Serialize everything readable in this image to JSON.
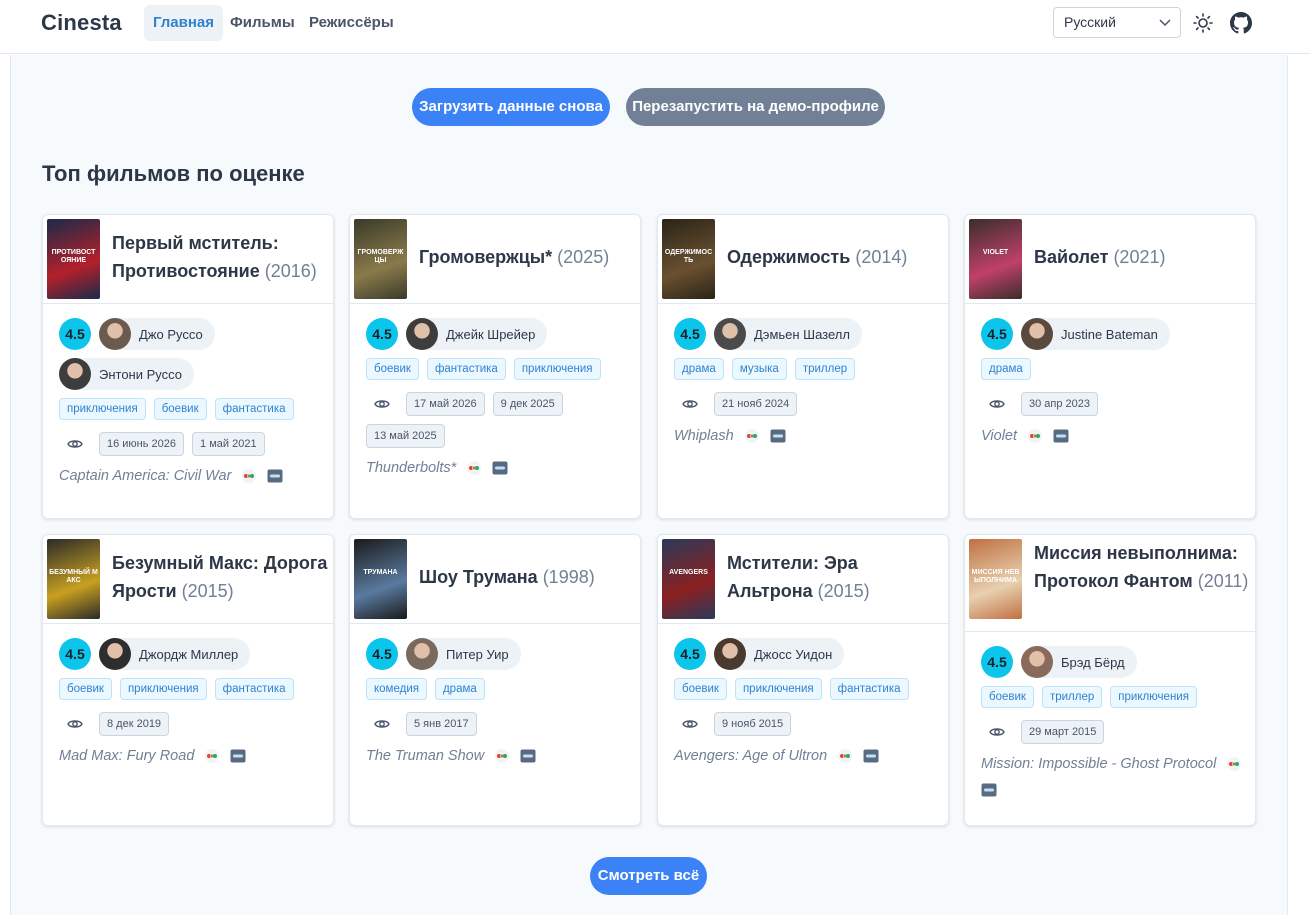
{
  "header": {
    "brand": "Cinesta",
    "nav": [
      {
        "label": "Главная",
        "active": true
      },
      {
        "label": "Фильмы",
        "active": false
      },
      {
        "label": "Режиссёры",
        "active": false
      }
    ],
    "language": "Русский"
  },
  "actions": {
    "reload_label": "Загрузить данные снова",
    "restart_label": "Перезапустить на демо-профиле"
  },
  "section_title": "Топ фильмов по оценке",
  "see_all_label": "Смотреть всё",
  "colors": {
    "accent": "#3b82f6",
    "rating": "#0bc5ea",
    "gray_button": "#718096"
  },
  "movies": [
    {
      "title": "Первый мститель: Противостояние",
      "year": "(2016)",
      "rating": "4.5",
      "directors": [
        "Джо Руссо",
        "Энтони Руссо"
      ],
      "genres": [
        "приключения",
        "боевик",
        "фантастика"
      ],
      "dates": [
        "16 июнь 2026",
        "1 май 2021"
      ],
      "original_title": "Captain America: Civil War"
    },
    {
      "title": "Громовержцы*",
      "year": "(2025)",
      "rating": "4.5",
      "directors": [
        "Джейк Шрейер"
      ],
      "genres": [
        "боевик",
        "фантастика",
        "приключения"
      ],
      "dates": [
        "17 май 2026",
        "9 дек 2025",
        "13 май 2025"
      ],
      "original_title": "Thunderbolts*"
    },
    {
      "title": "Одержимость",
      "year": "(2014)",
      "rating": "4.5",
      "directors": [
        "Дэмьен Шазелл"
      ],
      "genres": [
        "драма",
        "музыка",
        "триллер"
      ],
      "dates": [
        "21 нояб 2024"
      ],
      "original_title": "Whiplash"
    },
    {
      "title": "Вайолет",
      "year": "(2021)",
      "rating": "4.5",
      "directors": [
        "Justine Bateman"
      ],
      "genres": [
        "драма"
      ],
      "dates": [
        "30 апр 2023"
      ],
      "original_title": "Violet"
    },
    {
      "title": "Безумный Макс: Дорога Ярости",
      "year": "(2015)",
      "rating": "4.5",
      "directors": [
        "Джордж Миллер"
      ],
      "genres": [
        "боевик",
        "приключения",
        "фантастика"
      ],
      "dates": [
        "8 дек 2019"
      ],
      "original_title": "Mad Max: Fury Road"
    },
    {
      "title": "Шоу Трумана",
      "year": "(1998)",
      "rating": "4.5",
      "directors": [
        "Питер Уир"
      ],
      "genres": [
        "комедия",
        "драма"
      ],
      "dates": [
        "5 янв 2017"
      ],
      "original_title": "The Truman Show"
    },
    {
      "title": "Мстители: Эра Альтрона",
      "year": "(2015)",
      "rating": "4.5",
      "directors": [
        "Джосс Уидон"
      ],
      "genres": [
        "боевик",
        "приключения",
        "фантастика"
      ],
      "dates": [
        "9 нояб 2015"
      ],
      "original_title": "Avengers: Age of Ultron"
    },
    {
      "title": "Миссия невыполнима: Протокол Фантом",
      "year": "(2011)",
      "rating": "4.5",
      "directors": [
        "Брэд Бёрд"
      ],
      "genres": [
        "боевик",
        "триллер",
        "приключения"
      ],
      "dates": [
        "29 март 2015"
      ],
      "original_title": "Mission: Impossible - Ghost Protocol"
    }
  ],
  "poster_texts": {
    "m0": "ПРОТИВОСТОЯНИЕ",
    "m1": "ГРОМОВЕРЖЦЫ",
    "m2": "ОДЕРЖИМОСТЬ",
    "m3": "VIOLET",
    "m4": "БЕЗУМНЫЙ МАКС",
    "m5": "ТРУМАНА",
    "m6": "AVENGERS",
    "m7": "МИССИЯ НЕВЫПОЛНИМА"
  }
}
